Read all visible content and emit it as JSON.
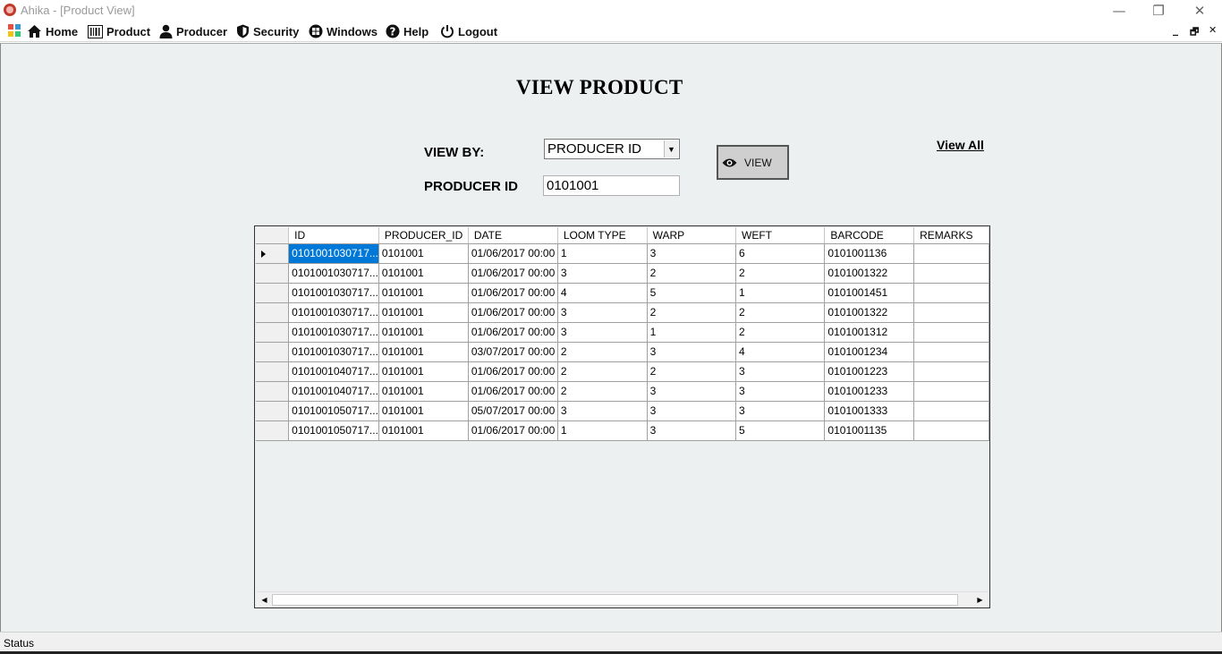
{
  "window": {
    "title": "Ahika - [Product View]",
    "minimize_glyph": "—",
    "restore_glyph": "❐",
    "close_glyph": "✕"
  },
  "menu": {
    "items": [
      {
        "label": "Home",
        "icon": "home-icon"
      },
      {
        "label": "Product",
        "icon": "barcode-icon"
      },
      {
        "label": "Producer",
        "icon": "person-icon"
      },
      {
        "label": "Security",
        "icon": "shield-icon"
      },
      {
        "label": "Windows",
        "icon": "windows-icon"
      },
      {
        "label": "Help",
        "icon": "help-icon"
      },
      {
        "label": "Logout",
        "icon": "power-icon"
      }
    ],
    "mdi_minimize": "_",
    "mdi_restore": "🗗",
    "mdi_close": "✕"
  },
  "form": {
    "title": "VIEW PRODUCT",
    "view_by_label": "VIEW BY:",
    "view_by_value": "PRODUCER ID",
    "producer_id_label": "PRODUCER ID",
    "producer_id_value": "0101001",
    "view_button_label": "VIEW",
    "view_all_label": "View All"
  },
  "grid": {
    "columns": [
      "ID",
      "PRODUCER_ID",
      "DATE",
      "LOOM TYPE",
      "WARP",
      "WEFT",
      "BARCODE",
      "REMARKS"
    ],
    "rows": [
      [
        "0101001030717...",
        "0101001",
        "01/06/2017 00:00",
        "1",
        "3",
        "6",
        "0101001136",
        ""
      ],
      [
        "0101001030717...",
        "0101001",
        "01/06/2017 00:00",
        "3",
        "2",
        "2",
        "0101001322",
        ""
      ],
      [
        "0101001030717...",
        "0101001",
        "01/06/2017 00:00",
        "4",
        "5",
        "1",
        "0101001451",
        ""
      ],
      [
        "0101001030717...",
        "0101001",
        "01/06/2017 00:00",
        "3",
        "2",
        "2",
        "0101001322",
        ""
      ],
      [
        "0101001030717...",
        "0101001",
        "01/06/2017 00:00",
        "3",
        "1",
        "2",
        "0101001312",
        ""
      ],
      [
        "0101001030717...",
        "0101001",
        "03/07/2017 00:00",
        "2",
        "3",
        "4",
        "0101001234",
        ""
      ],
      [
        "0101001040717...",
        "0101001",
        "01/06/2017 00:00",
        "2",
        "2",
        "3",
        "0101001223",
        ""
      ],
      [
        "0101001040717...",
        "0101001",
        "01/06/2017 00:00",
        "2",
        "3",
        "3",
        "0101001233",
        ""
      ],
      [
        "0101001050717...",
        "0101001",
        "05/07/2017 00:00",
        "3",
        "3",
        "3",
        "0101001333",
        ""
      ],
      [
        "0101001050717...",
        "0101001",
        "01/06/2017 00:00",
        "1",
        "3",
        "5",
        "0101001135",
        ""
      ]
    ],
    "selected_row": 0,
    "selection_color": "#0078d7"
  },
  "status": {
    "text": "Status"
  }
}
